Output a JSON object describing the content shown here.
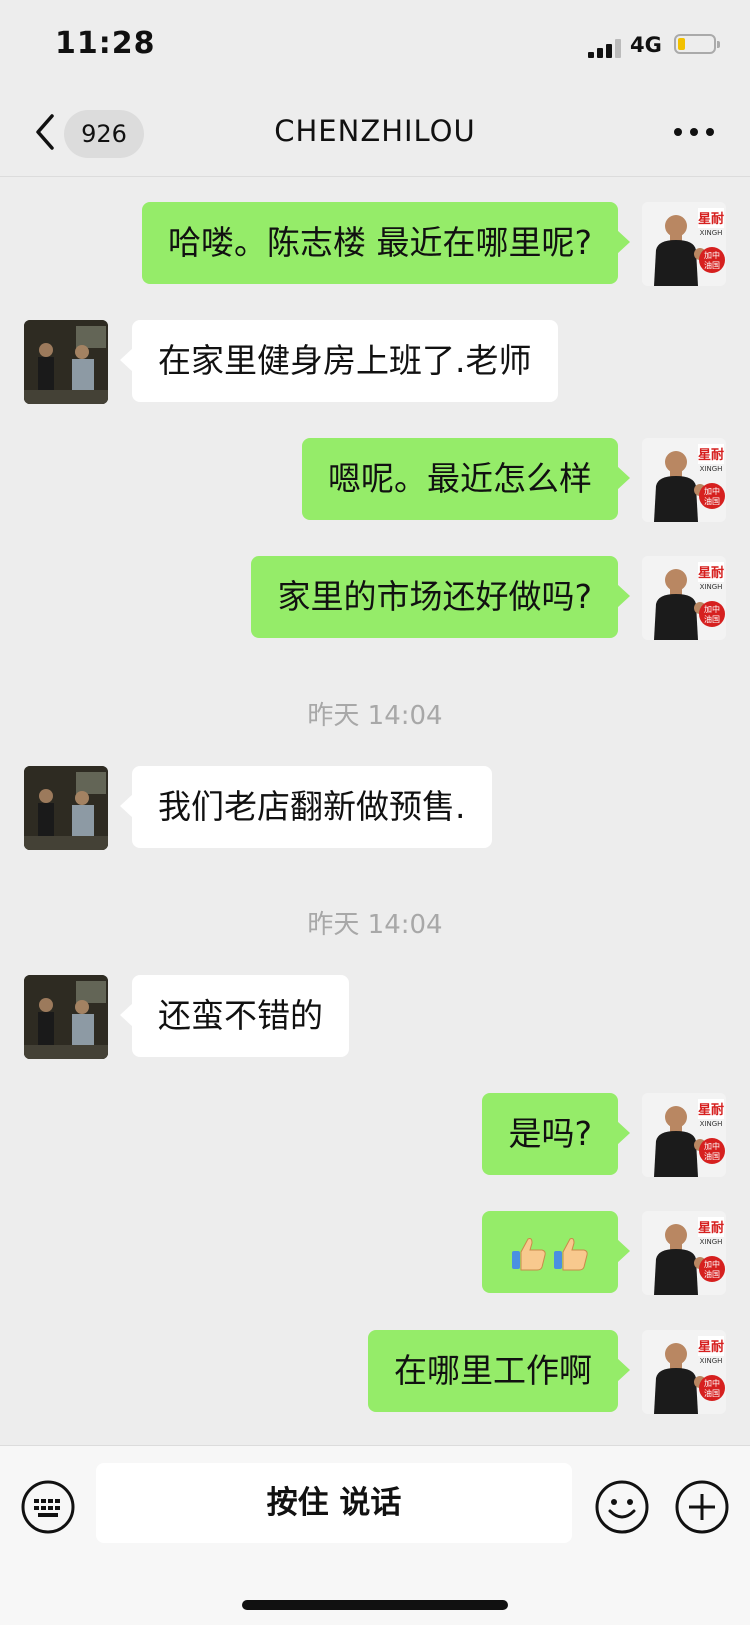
{
  "status_bar": {
    "time": "11:28",
    "network": "4G",
    "battery_color": "#f2c100"
  },
  "nav": {
    "unread_count": "926",
    "title": "CHENZHILOU"
  },
  "messages": [
    {
      "from": "me",
      "text": "哈喽。陈志楼 最近在哪里呢?"
    },
    {
      "from": "other",
      "text": "在家里健身房上班了.老师"
    },
    {
      "from": "me",
      "text": "嗯呢。最近怎么样"
    },
    {
      "from": "me",
      "text": "家里的市场还好做吗?"
    },
    {
      "timestamp": "昨天 14:04"
    },
    {
      "from": "other",
      "text": "我们老店翻新做预售."
    },
    {
      "timestamp": "昨天 14:04"
    },
    {
      "from": "other",
      "text": "还蛮不错的"
    },
    {
      "from": "me",
      "text": "是吗?"
    },
    {
      "from": "me",
      "emoji": [
        "thumbs-up",
        "thumbs-up"
      ]
    },
    {
      "from": "me",
      "text": "在哪里工作啊"
    }
  ],
  "my_avatar": {
    "brand_text": "星耐",
    "brand_sub": "XINGH",
    "badge_text": "加中",
    "badge_sub": "油国"
  },
  "input": {
    "hold_to_talk_label": "按住 说话"
  },
  "colors": {
    "my_bubble": "#95ec69",
    "other_bubble": "#ffffff",
    "background": "#ededed"
  }
}
